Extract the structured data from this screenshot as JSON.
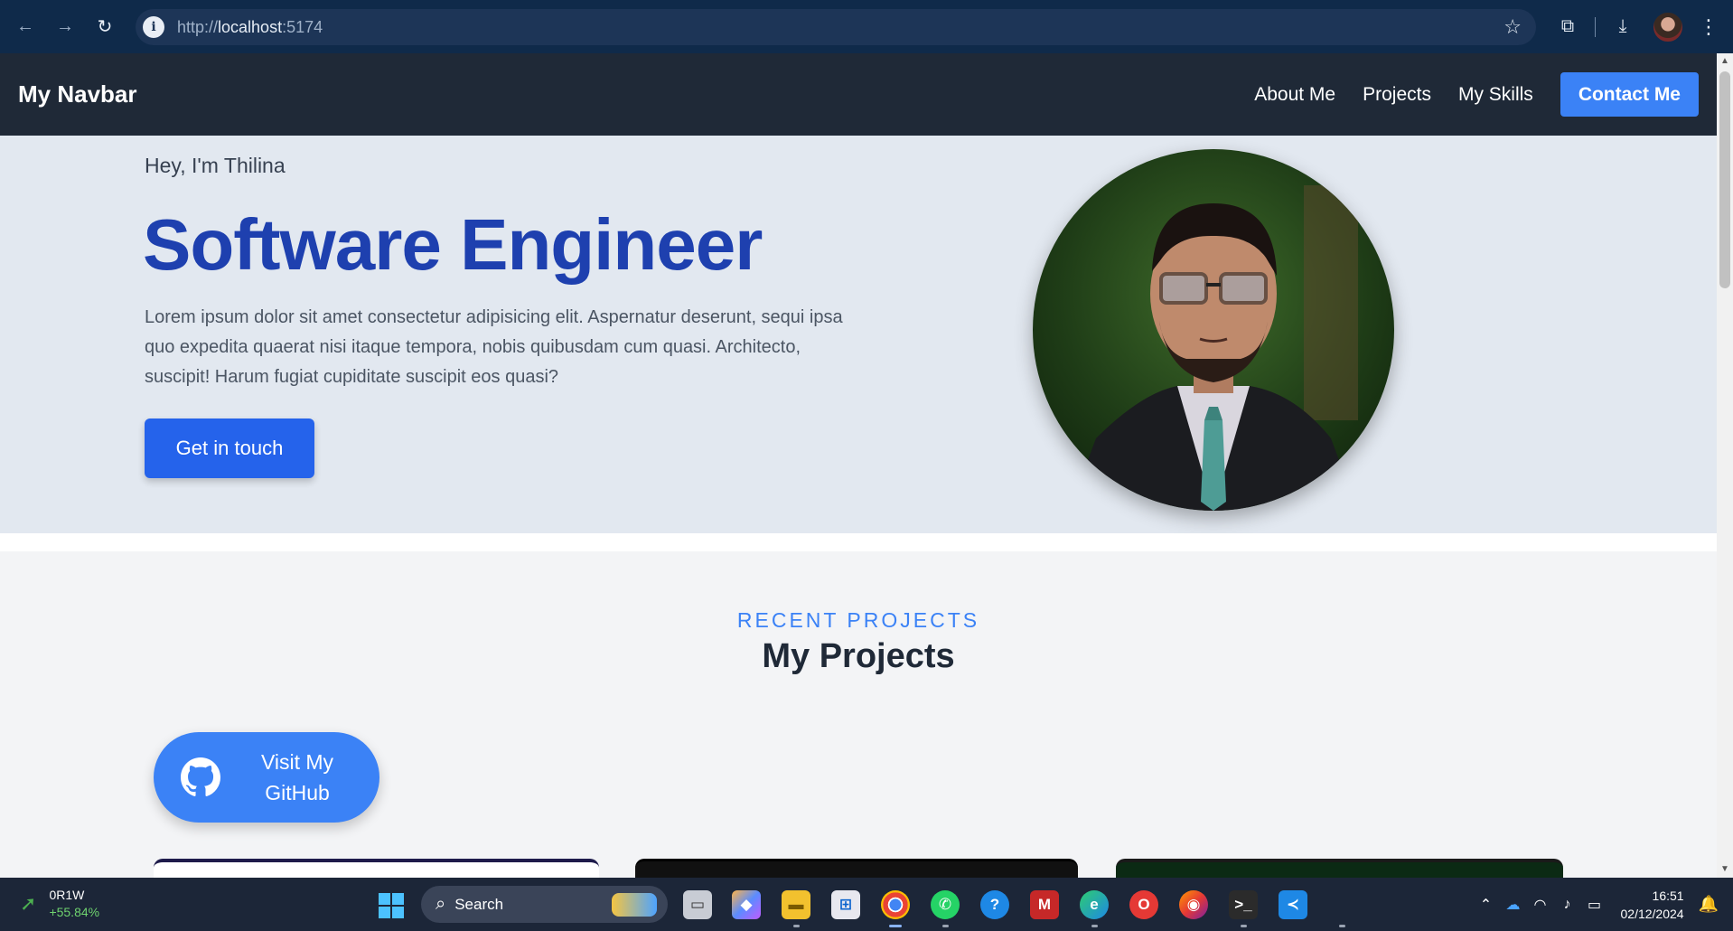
{
  "browser": {
    "url_scheme": "http://",
    "url_host": "localhost",
    "url_port": ":5174"
  },
  "navbar": {
    "brand": "My Navbar",
    "links": [
      "About Me",
      "Projects",
      "My Skills"
    ],
    "contact_label": "Contact Me"
  },
  "hero": {
    "greeting": "Hey, I'm Thilina",
    "title": "Software Engineer",
    "description": "Lorem ipsum dolor sit amet consectetur adipisicing elit. Aspernatur deserunt, sequi ipsa quo expedita quaerat nisi itaque tempora, nobis quibusdam cum quasi. Architecto, suscipit! Harum fugiat cupiditate suscipit eos quasi?",
    "cta_label": "Get in touch"
  },
  "projects": {
    "eyebrow": "RECENT PROJECTS",
    "title": "My Projects",
    "github_label": "Visit My GitHub"
  },
  "taskbar": {
    "stock_name": "0R1W",
    "stock_change": "+55.84%",
    "search_label": "Search",
    "time": "16:51",
    "date": "02/12/2024"
  },
  "colors": {
    "accent": "#3b82f6",
    "hero_title": "#1e40af",
    "navbar_bg": "#1f2937",
    "hero_bg": "#e2e8f0"
  }
}
